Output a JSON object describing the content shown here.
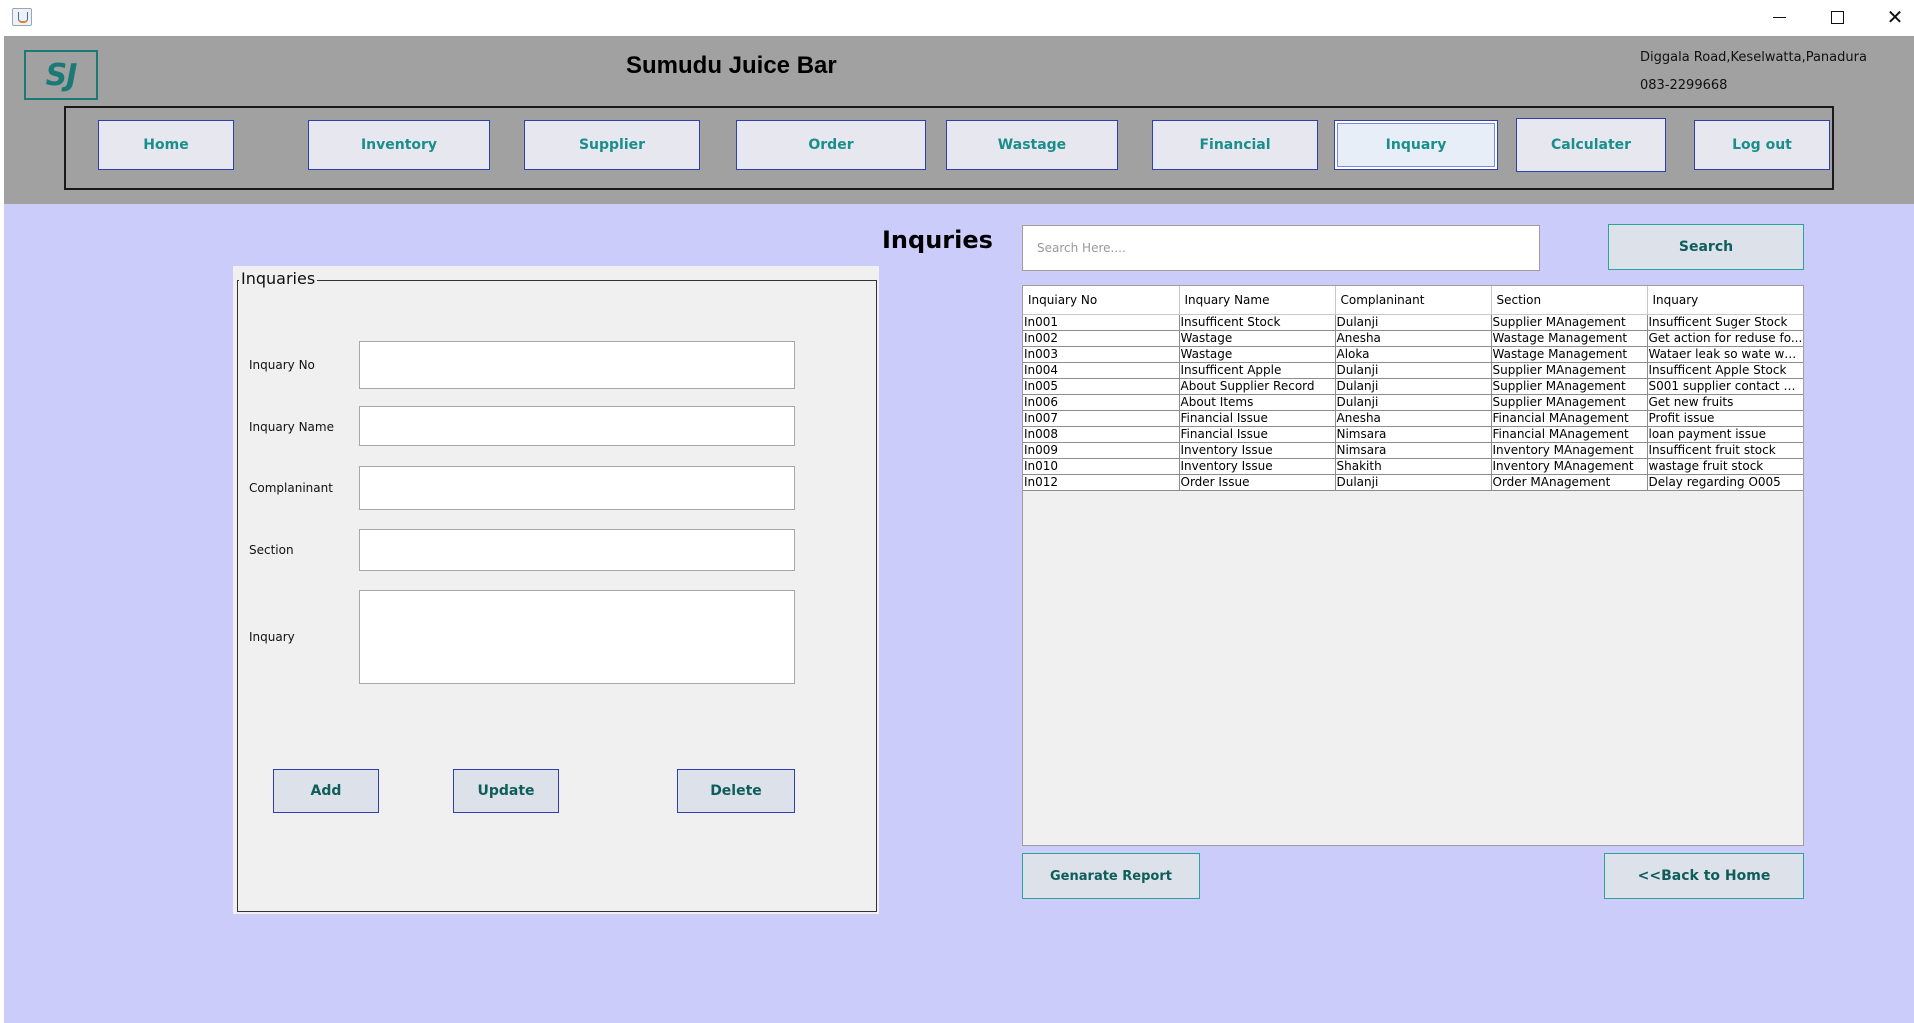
{
  "window": {
    "icon": "java-app-icon",
    "controls": {
      "minimize": "minimize-icon",
      "maximize": "maximize-icon",
      "close": "✕"
    }
  },
  "header": {
    "logo": "SJ",
    "title": "Sumudu Juice Bar",
    "address": "Diggala Road,Keselwatta,Panadura",
    "phone": "083-2299668"
  },
  "nav": {
    "items": [
      {
        "label": "Home"
      },
      {
        "label": "Inventory"
      },
      {
        "label": "Supplier"
      },
      {
        "label": "Order"
      },
      {
        "label": "Wastage"
      },
      {
        "label": "Financial"
      },
      {
        "label": "Inquary"
      },
      {
        "label": "Calculater"
      },
      {
        "label": "Log out"
      }
    ],
    "active": "Inquary"
  },
  "form": {
    "legend": "Inquaries",
    "fields": {
      "no": {
        "label": "Inquary No",
        "value": ""
      },
      "name": {
        "label": "Inquary Name",
        "value": ""
      },
      "complainant": {
        "label": "Complaninant",
        "value": ""
      },
      "section": {
        "label": "Section",
        "value": ""
      },
      "inquiry": {
        "label": "Inquary",
        "value": ""
      }
    },
    "buttons": {
      "add": "Add",
      "update": "Update",
      "delete": "Delete"
    }
  },
  "main": {
    "title": "Inquries",
    "search": {
      "placeholder": "Search Here....",
      "button": "Search"
    },
    "report_button": "Genarate Report",
    "back_button": "<<Back to Home"
  },
  "table": {
    "columns": [
      "Inquiary No",
      "Inquary Name",
      "Complaninant",
      "Section",
      "Inquary"
    ],
    "rows": [
      [
        "In001",
        "Insufficent Stock",
        "Dulanji",
        "Supplier MAnagement",
        "Insufficent Suger Stock"
      ],
      [
        "In002",
        "Wastage",
        "Anesha",
        "Wastage Management",
        "Get action for reduse fo..."
      ],
      [
        "In003",
        "Wastage",
        "Aloka",
        "Wastage Management",
        "Wataer leak so wate wa..."
      ],
      [
        "In004",
        "Insufficent Apple",
        "Dulanji",
        "Supplier MAnagement",
        "Insufficent Apple Stock"
      ],
      [
        "In005",
        "About Supplier Record",
        "Dulanji",
        "Supplier MAnagement",
        "S001 supplier contact no..."
      ],
      [
        "In006",
        "About Items",
        "Dulanji",
        "Supplier MAnagement",
        "Get new fruits"
      ],
      [
        "In007",
        "Financial Issue",
        "Anesha",
        "Financial MAnagement",
        "Profit issue"
      ],
      [
        "In008",
        "Financial Issue",
        "Nimsara",
        "Financial MAnagement",
        "loan payment issue"
      ],
      [
        "In009",
        "Inventory Issue",
        "Nimsara",
        "Inventory MAnagement",
        "Insufficent fruit stock"
      ],
      [
        "In010",
        "Inventory Issue",
        "Shakith",
        "Inventory MAnagement",
        "wastage fruit stock"
      ],
      [
        "In012",
        "Order Issue",
        "Dulanji",
        "Order MAnagement",
        "Delay regarding O005"
      ]
    ]
  },
  "colors": {
    "header_bg": "#a1a1a1",
    "main_bg": "#ccccfb",
    "accent_text": "#1a8e8a",
    "button_border": "#2f3fb8"
  }
}
